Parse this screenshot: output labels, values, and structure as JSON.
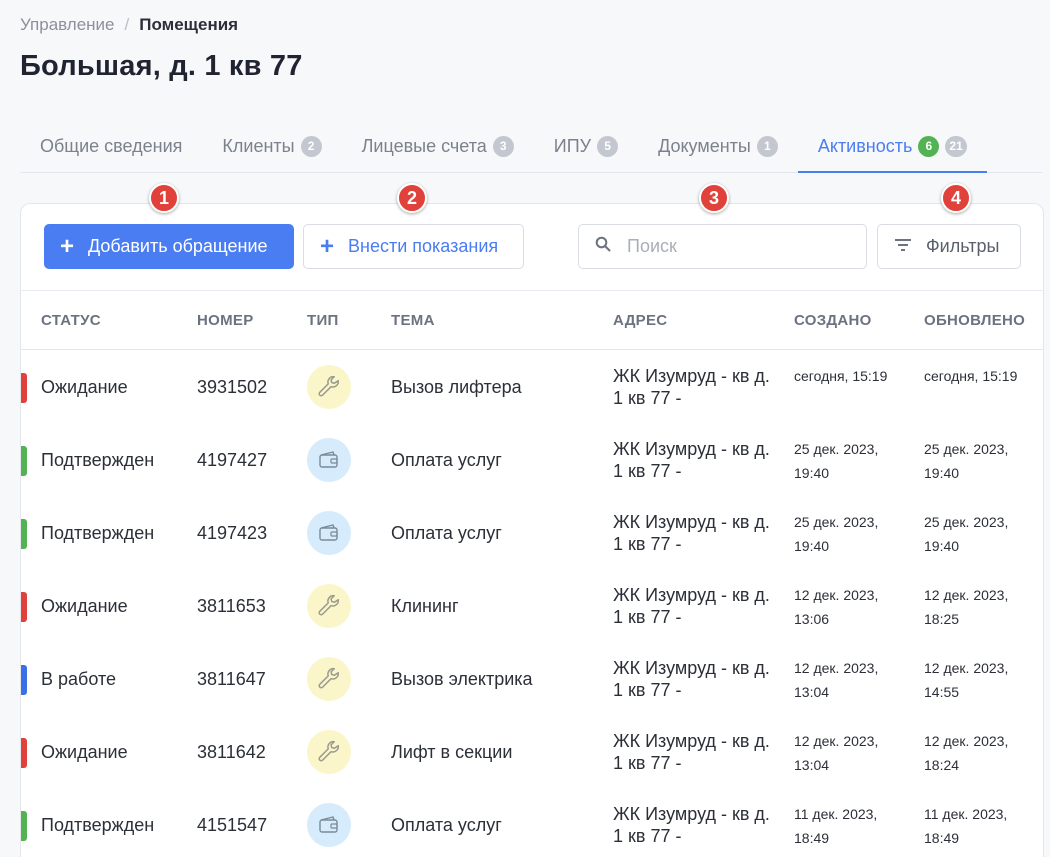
{
  "breadcrumb": {
    "parent": "Управление",
    "separator": "/",
    "current": "Помещения"
  },
  "page_title": "Большая, д. 1 кв 77",
  "tabs": [
    {
      "label": "Общие сведения",
      "badges": []
    },
    {
      "label": "Клиенты",
      "badges": [
        "2"
      ]
    },
    {
      "label": "Лицевые счета",
      "badges": [
        "3"
      ]
    },
    {
      "label": "ИПУ",
      "badges": [
        "5"
      ]
    },
    {
      "label": "Документы",
      "badges": [
        "1"
      ]
    },
    {
      "label": "Активность",
      "badges": [
        "6",
        "21"
      ],
      "active": true
    }
  ],
  "toolbar": {
    "add_request_label": "Добавить обращение",
    "submit_readings_label": "Внести показания",
    "search_placeholder": "Поиск",
    "filters_label": "Фильтры"
  },
  "markers": [
    "1",
    "2",
    "3",
    "4"
  ],
  "table": {
    "headers": {
      "status": "СТАТУС",
      "number": "НОМЕР",
      "type": "ТИП",
      "topic": "ТЕМА",
      "address": "АДРЕС",
      "created": "СОЗДАНО",
      "updated": "ОБНОВЛЕНО"
    },
    "rows": [
      {
        "status": "Ожидание",
        "number": "3931502",
        "type": "wrench-icon",
        "topic": "Вызов лифтера",
        "address": "ЖК Изумруд - кв д. 1 кв 77 -",
        "created": "сегодня, 15:19",
        "updated": "сегодня, 15:19"
      },
      {
        "status": "Подтвержден",
        "number": "4197427",
        "type": "wallet-icon",
        "topic": "Оплата услуг",
        "address": "ЖК Изумруд - кв д. 1 кв 77 -",
        "created": "25 дек. 2023, 19:40",
        "updated": "25 дек. 2023, 19:40"
      },
      {
        "status": "Подтвержден",
        "number": "4197423",
        "type": "wallet-icon",
        "topic": "Оплата услуг",
        "address": "ЖК Изумруд - кв д. 1 кв 77 -",
        "created": "25 дек. 2023, 19:40",
        "updated": "25 дек. 2023, 19:40"
      },
      {
        "status": "Ожидание",
        "number": "3811653",
        "type": "wrench-icon",
        "topic": "Клининг",
        "address": "ЖК Изумруд - кв д. 1 кв 77 -",
        "created": "12 дек. 2023, 13:06",
        "updated": "12 дек. 2023, 18:25"
      },
      {
        "status": "В работе",
        "number": "3811647",
        "type": "wrench-icon",
        "topic": "Вызов электрика",
        "address": "ЖК Изумруд - кв д. 1 кв 77 -",
        "created": "12 дек. 2023, 13:04",
        "updated": "12 дек. 2023, 14:55"
      },
      {
        "status": "Ожидание",
        "number": "3811642",
        "type": "wrench-icon",
        "topic": "Лифт в секции",
        "address": "ЖК Изумруд - кв д. 1 кв 77 -",
        "created": "12 дек. 2023, 13:04",
        "updated": "12 дек. 2023, 18:24"
      },
      {
        "status": "Подтвержден",
        "number": "4151547",
        "type": "wallet-icon",
        "topic": "Оплата услуг",
        "address": "ЖК Изумруд - кв д. 1 кв 77 -",
        "created": "11 дек. 2023, 18:49",
        "updated": "11 дек. 2023, 18:49"
      }
    ]
  },
  "colors": {
    "accent": "#4a7cf2",
    "status_waiting": "#e0413a",
    "status_confirmed": "#52b254",
    "status_in_progress": "#3b6fe8",
    "badge_green": "#52b254",
    "badge_gray": "#c3c7cf",
    "marker": "#e0413a"
  }
}
